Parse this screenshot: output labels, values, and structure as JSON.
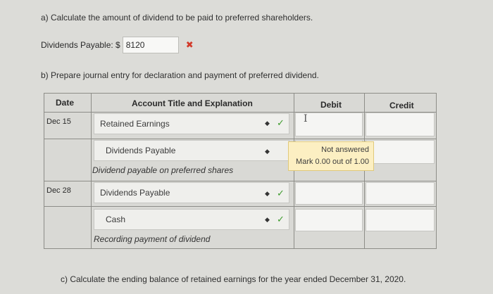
{
  "questions": {
    "a": "a) Calculate the amount of dividend to be paid to preferred shareholders.",
    "b": "b) Prepare journal entry for declaration and payment of preferred dividend.",
    "c": "c) Calculate the ending balance of retained earnings for the year ended December 31, 2020."
  },
  "dividends_payable": {
    "label": "Dividends Payable: $",
    "value": "8120",
    "status_icon": "cross-icon",
    "status_glyph": "✖",
    "status_color": "#d23a2a"
  },
  "table": {
    "headers": {
      "date": "Date",
      "account": "Account Title and Explanation",
      "debit": "Debit",
      "credit": "Credit"
    },
    "rows": [
      {
        "date": "Dec 15",
        "account": "Retained Earnings",
        "check": "✓"
      },
      {
        "date": "",
        "account": "Dividends Payable",
        "memo": "Dividend payable on preferred shares"
      },
      {
        "date": "Dec 28",
        "account": "Dividends Payable",
        "check": "✓"
      },
      {
        "date": "",
        "account": "Cash",
        "check": "✓",
        "memo": "Recording payment of dividend"
      }
    ],
    "status": {
      "line1": "Not answered",
      "line2": "Mark 0.00 out of 1.00"
    },
    "cursor": "I",
    "select_arrow": "◆"
  },
  "colors": {
    "check": "#3d9b2c",
    "status_bg": "#fcefc2"
  }
}
